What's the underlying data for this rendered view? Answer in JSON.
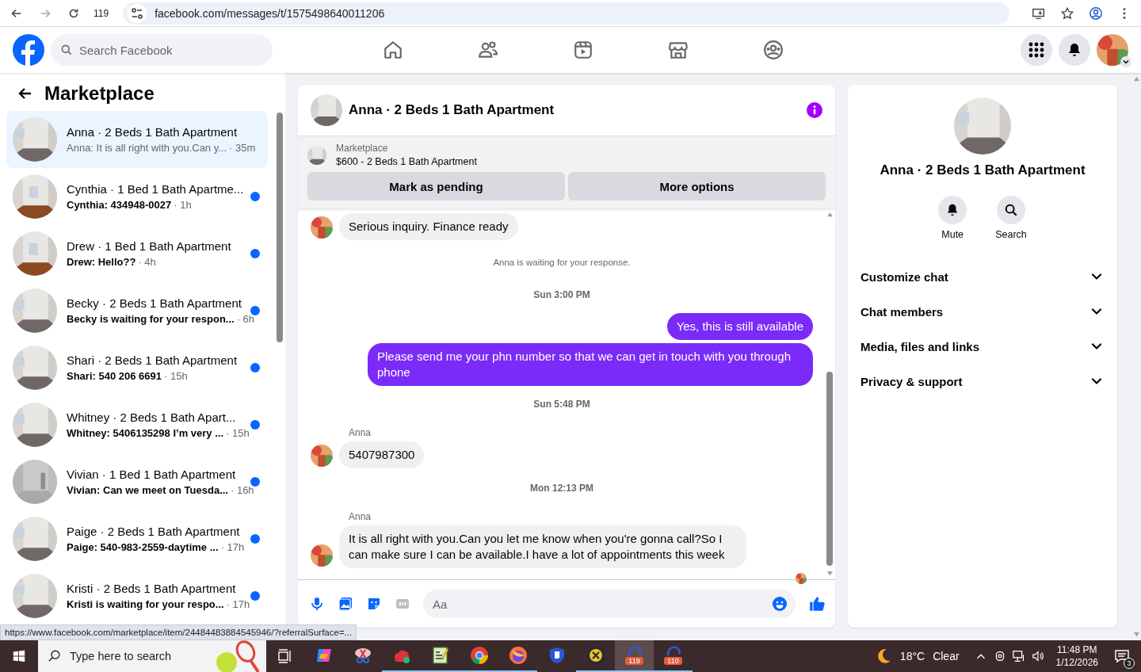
{
  "browser": {
    "tab_count": "119",
    "url": "facebook.com/messages/t/1575498640011206"
  },
  "header": {
    "search": {
      "placeholder": "Search Facebook"
    },
    "nav": [
      {
        "kind": "home"
      },
      {
        "kind": "friends"
      },
      {
        "kind": "video"
      },
      {
        "kind": "marketplace"
      },
      {
        "kind": "groups"
      }
    ]
  },
  "sidebar": {
    "title": "Marketplace",
    "conversations": [
      {
        "name": "Anna · 2 Beds 1 Bath Apartment",
        "preview": "Anna: It is all right with you.Can y...",
        "time": "· 35m",
        "unread": false,
        "selected": true
      },
      {
        "name": "Cynthia · 1 Bed 1 Bath Apartme...",
        "preview": "Cynthia: 434948-0027",
        "time": "· 1h",
        "unread": true,
        "selected": false
      },
      {
        "name": "Drew · 1 Bed 1 Bath Apartment",
        "preview": "Drew: Hello??",
        "time": "· 4h",
        "unread": true,
        "selected": false
      },
      {
        "name": "Becky · 2 Beds 1 Bath Apartment",
        "preview": "Becky is waiting for your respon...",
        "time": "· 6h",
        "unread": true,
        "selected": false
      },
      {
        "name": "Shari · 2 Beds 1 Bath Apartment",
        "preview": "Shari: 540 206 6691",
        "time": "· 15h",
        "unread": true,
        "selected": false
      },
      {
        "name": "Whitney · 2 Beds 1 Bath Apart...",
        "preview": "Whitney: 5406135298 I’m very ...",
        "time": "· 15h",
        "unread": true,
        "selected": false
      },
      {
        "name": "Vivian · 1 Bed 1 Bath Apartment",
        "preview": "Vivian: Can we meet on Tuesda...",
        "time": "· 16h",
        "unread": true,
        "selected": false
      },
      {
        "name": "Paige · 2 Beds 1 Bath Apartment",
        "preview": "Paige: 540-983-2559-daytime ...",
        "time": "· 17h",
        "unread": true,
        "selected": false
      },
      {
        "name": "Kristi · 2 Beds 1 Bath Apartment",
        "preview": "Kristi is waiting for your respo...",
        "time": "· 17h",
        "unread": true,
        "selected": false
      }
    ]
  },
  "chat": {
    "title": "Anna · 2 Beds 1 Bath Apartment",
    "listing": {
      "label": "Marketplace",
      "title": "$600 - 2 Beds 1 Bath Apartment"
    },
    "actions": [
      "Mark as pending",
      "More options"
    ],
    "messages": [
      {
        "kind": "incoming",
        "text": "Serious inquiry. Finance ready"
      },
      {
        "kind": "notice",
        "text": "Anna is waiting for your response."
      },
      {
        "kind": "timestamp",
        "text": "Sun 3:00 PM"
      },
      {
        "kind": "outgoing",
        "text": "Yes, this is still available"
      },
      {
        "kind": "outgoing",
        "text": "Please send me your phn number so that we can get in touch with you through phone"
      },
      {
        "kind": "timestamp",
        "text": "Sun 5:48 PM"
      },
      {
        "kind": "sender",
        "text": "Anna"
      },
      {
        "kind": "incoming",
        "text": "5407987300"
      },
      {
        "kind": "timestamp",
        "text": "Mon 12:13 PM"
      },
      {
        "kind": "sender",
        "text": "Anna"
      },
      {
        "kind": "incoming",
        "text": "It is all right with you.Can you let me know when you're gonna call?So I can make sure I can be available.I have a lot of appointments this week"
      }
    ],
    "composer": {
      "placeholder": "Aa"
    }
  },
  "details": {
    "title": "Anna · 2 Beds 1 Bath Apartment",
    "actions": [
      {
        "kind": "mute",
        "label": "Mute"
      },
      {
        "kind": "search",
        "label": "Search"
      }
    ],
    "sections": [
      {
        "label": "Customize chat",
        "expanded": false
      },
      {
        "label": "Chat members",
        "expanded": false
      },
      {
        "label": "Media, files and links",
        "expanded": false
      },
      {
        "label": "Privacy & support",
        "expanded": false
      }
    ]
  },
  "status_url": "https://www.facebook.com/marketplace/item/24484483884545946/?referralSurface=...",
  "taskbar": {
    "search": {
      "placeholder": "Type here to search"
    },
    "apps": [
      {
        "kind": "copilot",
        "running": false,
        "selected": false
      },
      {
        "kind": "snip",
        "running": false,
        "selected": false
      },
      {
        "kind": "cloud",
        "running": true,
        "selected": false
      },
      {
        "kind": "notepad",
        "running": true,
        "selected": false
      },
      {
        "kind": "chrome",
        "running": true,
        "selected": false
      },
      {
        "kind": "firefox",
        "running": true,
        "selected": false
      },
      {
        "kind": "shield",
        "running": false,
        "selected": false
      },
      {
        "kind": "ix",
        "running": true,
        "selected": false
      },
      {
        "kind": "badge",
        "badge": "119",
        "running": true,
        "selected": true
      },
      {
        "kind": "badge",
        "badge": "110",
        "running": true,
        "selected": false
      }
    ],
    "weather": {
      "temp": "18°C",
      "condition": "Clear"
    },
    "clock": {
      "time": "11:48 PM",
      "date": "1/12/2026"
    },
    "notifications": "3"
  }
}
